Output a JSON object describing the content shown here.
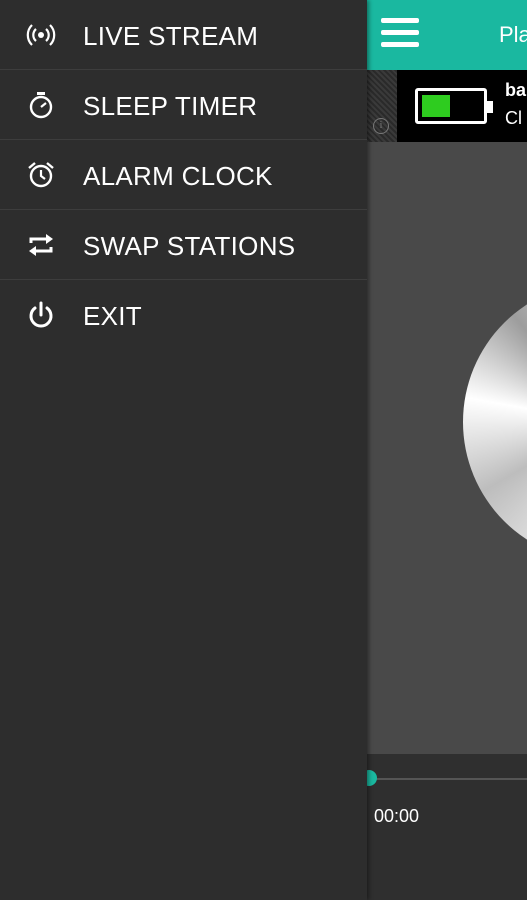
{
  "app": {
    "title": "Pla",
    "ad": {
      "line1": "ba",
      "line2": "Cl"
    },
    "player": {
      "elapsed": "00:00"
    }
  },
  "drawer": {
    "items": [
      {
        "label": "LIVE STREAM",
        "icon": "broadcast-icon"
      },
      {
        "label": "SLEEP TIMER",
        "icon": "stopwatch-icon"
      },
      {
        "label": "ALARM CLOCK",
        "icon": "alarm-clock-icon"
      },
      {
        "label": "SWAP STATIONS",
        "icon": "swap-icon"
      },
      {
        "label": "EXIT",
        "icon": "power-icon"
      }
    ]
  },
  "colors": {
    "accent": "#1ab8a0",
    "drawer_bg": "#2d2d2d",
    "battery_fill": "#2ecc1f"
  }
}
